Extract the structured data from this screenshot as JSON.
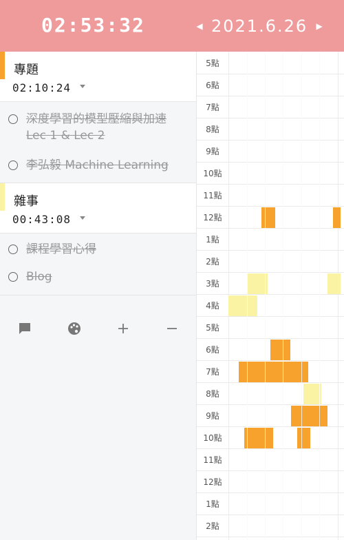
{
  "header": {
    "clock": "02:53:32",
    "date": "2021.6.26",
    "prev_icon": "triangle-left",
    "next_icon": "triangle-right",
    "color": "#ef9b9c"
  },
  "projects": [
    {
      "name": "專題",
      "time": "02:10:24",
      "color": "#f7a22c",
      "tasks": [
        "深度學習的模型壓縮與加速 Lec 1 & Lec 2",
        "李弘毅 Machine Learning"
      ]
    },
    {
      "name": "雜事",
      "time": "00:43:08",
      "color": "#fbf3a4",
      "tasks": [
        "課程學習心得",
        "Blog"
      ]
    }
  ],
  "toolbar": {
    "icons": [
      "comment-icon",
      "palette-icon",
      "plus-icon",
      "minus-icon"
    ]
  },
  "timeline": {
    "hours": [
      "5點",
      "6點",
      "7點",
      "8點",
      "9點",
      "10點",
      "11點",
      "12點",
      "1點",
      "2點",
      "3點",
      "4點",
      "5點",
      "6點",
      "7點",
      "8點",
      "9點",
      "10點",
      "11點",
      "12點",
      "1點",
      "2點"
    ]
  }
}
